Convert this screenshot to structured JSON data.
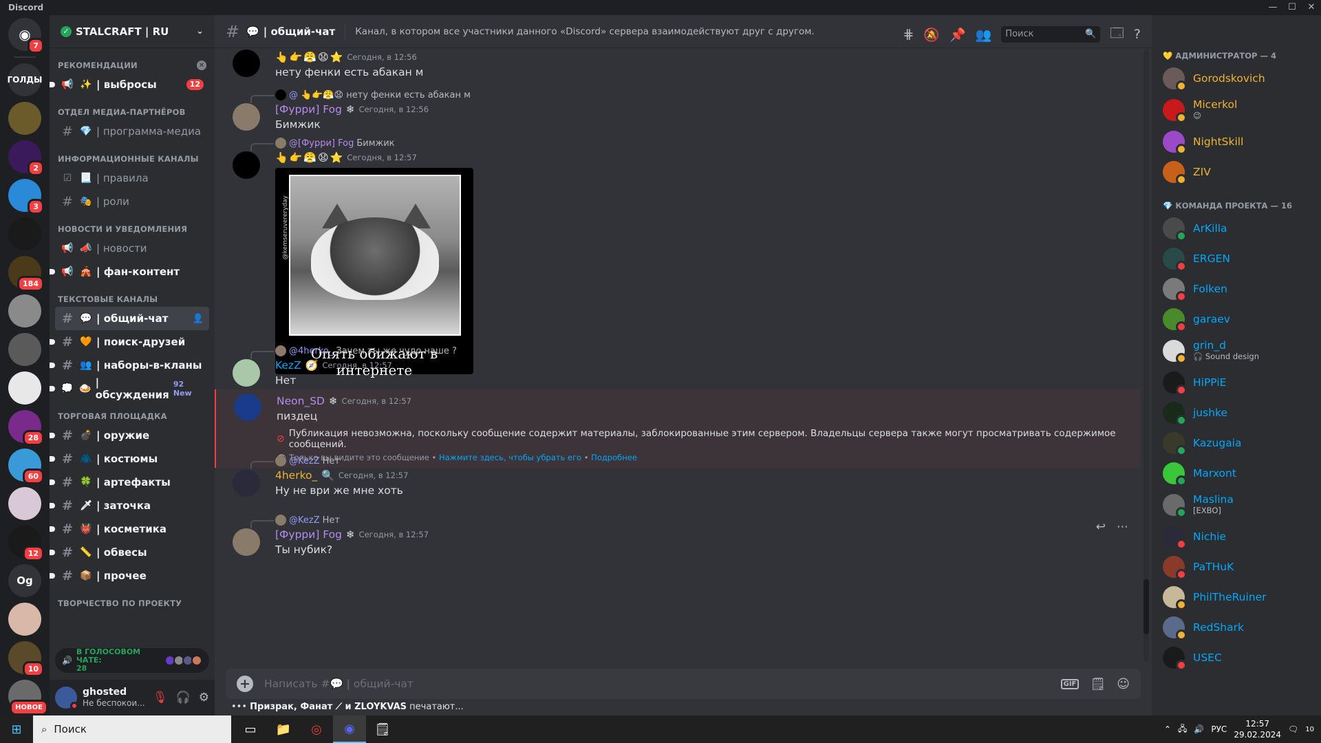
{
  "window": {
    "title": "Discord",
    "controls": [
      "—",
      "☐",
      "✕"
    ]
  },
  "rail": {
    "home_badge": "7",
    "servers": [
      {
        "label": "ГОЛДЫ",
        "color": "#313338",
        "badge": ""
      },
      {
        "label": "",
        "color": "#6b5a2a",
        "badge": ""
      },
      {
        "label": "",
        "color": "#3a1a5a",
        "badge": "2"
      },
      {
        "label": "",
        "color": "#2a8ad8",
        "badge": "3"
      },
      {
        "label": "",
        "color": "#1a1a1a",
        "badge": ""
      },
      {
        "label": "",
        "color": "#4a3a1a",
        "badge": "184"
      },
      {
        "label": "",
        "color": "#8a8a8a",
        "badge": ""
      },
      {
        "label": "",
        "color": "#5a5a5a",
        "badge": ""
      },
      {
        "label": "",
        "color": "#e8e8e8",
        "badge": ""
      },
      {
        "label": "",
        "color": "#7a2a8a",
        "badge": "28"
      },
      {
        "label": "",
        "color": "#3a9ad8",
        "badge": "60"
      },
      {
        "label": "",
        "color": "#d8c8d8",
        "badge": ""
      },
      {
        "label": "",
        "color": "#1a1a1a",
        "badge": "12"
      },
      {
        "label": "Og",
        "color": "#313338",
        "badge": ""
      },
      {
        "label": "",
        "color": "#d8b8a8",
        "badge": ""
      },
      {
        "label": "",
        "color": "#5a4a2a",
        "badge": "10"
      },
      {
        "label": "",
        "color": "#6a6a6a",
        "badge": "НОВОЕ"
      }
    ]
  },
  "guild": {
    "name": "STALCRAFT | RU",
    "categories": [
      {
        "name": "РЕКОМЕНДАЦИИ",
        "closable": true,
        "channels": [
          {
            "icon": "📢",
            "emoji": "✨",
            "name": "| выбросы",
            "state": "unread",
            "badge": "12",
            "new": ""
          }
        ]
      },
      {
        "name": "ОТДЕЛ МЕДИА-ПАРТНЁРОВ",
        "channels": [
          {
            "icon": "#",
            "emoji": "💎",
            "name": "| программа-медиа",
            "state": "",
            "badge": "",
            "new": ""
          }
        ]
      },
      {
        "name": "ИНФОРМАЦИОННЫЕ КАНАЛЫ",
        "channels": [
          {
            "icon": "☑",
            "emoji": "📃",
            "name": "| правила",
            "state": "",
            "badge": "",
            "new": ""
          },
          {
            "icon": "#",
            "emoji": "🎭",
            "name": "| роли",
            "state": "",
            "badge": "",
            "new": ""
          }
        ]
      },
      {
        "name": "НОВОСТИ И УВЕДОМЛЕНИЯ",
        "channels": [
          {
            "icon": "📢",
            "emoji": "📣",
            "name": "| новости",
            "state": "",
            "badge": "",
            "new": ""
          },
          {
            "icon": "📢",
            "emoji": "🎪",
            "name": "| фан-контент",
            "state": "unread",
            "badge": "",
            "new": ""
          }
        ]
      },
      {
        "name": "ТЕКСТОВЫЕ КАНАЛЫ",
        "channels": [
          {
            "icon": "#",
            "emoji": "💬",
            "name": "| общий-чат",
            "state": "active",
            "badge": "",
            "new": ""
          },
          {
            "icon": "#",
            "emoji": "🧡",
            "name": "| поиск-друзей",
            "state": "unread",
            "badge": "",
            "new": ""
          },
          {
            "icon": "#",
            "emoji": "👥",
            "name": "| наборы-в-кланы",
            "state": "unread",
            "badge": "",
            "new": ""
          },
          {
            "icon": "💭",
            "emoji": "🍛",
            "name": "| обсуждения",
            "state": "unread",
            "badge": "",
            "new": "92 New"
          }
        ]
      },
      {
        "name": "ТОРГОВАЯ ПЛОЩАДКА",
        "channels": [
          {
            "icon": "#",
            "emoji": "💣",
            "name": "| оружие",
            "state": "unread",
            "badge": "",
            "new": ""
          },
          {
            "icon": "#",
            "emoji": "🧥",
            "name": "| костюмы",
            "state": "unread",
            "badge": "",
            "new": ""
          },
          {
            "icon": "#",
            "emoji": "🍀",
            "name": "| артефакты",
            "state": "unread",
            "badge": "",
            "new": ""
          },
          {
            "icon": "#",
            "emoji": "🗡",
            "name": "| заточка",
            "state": "unread",
            "badge": "",
            "new": ""
          },
          {
            "icon": "#",
            "emoji": "👹",
            "name": "| косметика",
            "state": "unread",
            "badge": "",
            "new": ""
          },
          {
            "icon": "#",
            "emoji": "📏",
            "name": "| обвесы",
            "state": "unread",
            "badge": "",
            "new": ""
          },
          {
            "icon": "#",
            "emoji": "📦",
            "name": "| прочее",
            "state": "unread",
            "badge": "",
            "new": ""
          }
        ]
      },
      {
        "name": "ТВОРЧЕСТВО ПО ПРОЕКТУ",
        "channels": []
      }
    ]
  },
  "voice": {
    "label": "В ГОЛОСОВОМ ЧАТЕ:",
    "count": "28"
  },
  "user": {
    "name": "ghosted",
    "status": "Не беспокои..."
  },
  "chat": {
    "channel_emoji": "💬",
    "channel_name": "| общий-чат",
    "topic": "Канал, в котором все участники данного «Discord» сервера взаимодействуют друг с другом.",
    "search_placeholder": "Поиск",
    "composer_placeholder": "Написать #💬 | общий-чат",
    "typing": {
      "names": "Призрак, Фанат ⟋ и ZLOYKVAS",
      "suffix": " печатают..."
    },
    "messages": [
      {
        "author": "",
        "author_color": "#dbdee1",
        "emojis": "👆👉😤😧⭐",
        "time": "Сегодня, в 12:56",
        "text": "нету фенки есть абакан м",
        "avatar": "#000000",
        "reply_name": "",
        "reply_text": ""
      },
      {
        "author": "[Фурри] Fog",
        "author_color": "#b78bee",
        "emojis": "❄",
        "time": "Сегодня, в 12:56",
        "text": "Бимжик",
        "avatar": "#8a7a6a",
        "reply_name": "@",
        "reply_text": "👆👉😤😧 нету фенки есть абакан м"
      },
      {
        "author": "",
        "author_color": "#dbdee1",
        "emojis": "👆👉😤😧⭐",
        "time": "Сегодня, в 12:57",
        "text": "",
        "avatar": "#000000",
        "reply_name": "@[Фурри] Fog",
        "reply_text": "Бимжик",
        "gif": {
          "caption": "Опять обижают в интернете",
          "watermark": "@kemseruvereryday"
        }
      },
      {
        "author": "KezZ",
        "author_color": "#00a8fc",
        "emojis": "🧭",
        "time": "Сегодня, в 12:57",
        "text": "Нет",
        "avatar": "#a8c8a8",
        "reply_name": "@4herko_",
        "reply_text": "Зачем ты же чудо наше ?"
      },
      {
        "author": "Neon_SD",
        "author_color": "#b78bee",
        "emojis": "❄",
        "time": "Сегодня, в 12:57",
        "text": "пиздец",
        "avatar": "#1a3a8a",
        "reply_name": "",
        "reply_text": "",
        "blocked": {
          "text": "Публикация невозможна, поскольку сообщение содержит материалы, заблокированные этим сервером. Владельцы сервера также могут просматривать содержимое сообщений.",
          "only_you": "Только вы видите это сообщение •",
          "dismiss": "Нажмите здесь, чтобы убрать его",
          "sep": "•",
          "more": "Подробнее"
        }
      },
      {
        "author": "4herko_",
        "author_color": "#f0b232",
        "emojis": "🔍",
        "time": "Сегодня, в 12:57",
        "text": "Ну не ври же мне хоть",
        "avatar": "#2a2a3a",
        "reply_name": "@KezZ",
        "reply_text": "Нет"
      },
      {
        "author": "[Фурри] Fog",
        "author_color": "#b78bee",
        "emojis": "❄",
        "time": "Сегодня, в 12:57",
        "text": "Ты нубик?",
        "avatar": "#8a7a6a",
        "reply_name": "@KezZ",
        "reply_text": "Нет"
      }
    ]
  },
  "members": {
    "groups": [
      {
        "title": "💛 АДМИНИСТРАТОР — 4",
        "cls": "admin",
        "list": [
          {
            "name": "Gorodskovich",
            "sub": "",
            "color": "#6a5a5a",
            "status": "#f0b232"
          },
          {
            "name": "Micerkol",
            "sub": "😉",
            "color": "#c81a1a",
            "status": "#f0b232"
          },
          {
            "name": "NightSkill",
            "sub": "",
            "color": "#9a4ac8",
            "status": "#f0b232"
          },
          {
            "name": "ZIV",
            "sub": "",
            "color": "#c8601a",
            "status": "#f0b232"
          }
        ]
      },
      {
        "title": "💎 КОМАНДА ПРОЕКТА — 16",
        "cls": "team",
        "list": [
          {
            "name": "ArKilla",
            "sub": "",
            "color": "#4a4a4a",
            "status": "#23a55a"
          },
          {
            "name": "ERGEN",
            "sub": "",
            "color": "#2a4a4a",
            "status": "#f23f42"
          },
          {
            "name": "Folken",
            "sub": "",
            "color": "#7a7a7a",
            "status": "#f23f42"
          },
          {
            "name": "garaev",
            "sub": "",
            "color": "#4a8a2a",
            "status": "#f23f42"
          },
          {
            "name": "grin_d",
            "sub": "🎧 Sound design",
            "color": "#dadada",
            "status": "#f0b232"
          },
          {
            "name": "HiPPiE",
            "sub": "",
            "color": "#1a1a1a",
            "status": "#f23f42"
          },
          {
            "name": "jushke",
            "sub": "",
            "color": "#1a2a1a",
            "status": "#23a55a"
          },
          {
            "name": "Kazugaia",
            "sub": "",
            "color": "#3a3a2a",
            "status": "#23a55a"
          },
          {
            "name": "Marxont",
            "sub": "",
            "color": "#3ac83a",
            "status": "#23a55a"
          },
          {
            "name": "Maslina",
            "sub": "[EXBO]",
            "color": "#6a6a6a",
            "status": "#23a55a"
          },
          {
            "name": "Nichie",
            "sub": "",
            "color": "#2a2a3a",
            "status": "#f23f42"
          },
          {
            "name": "PaTHuK",
            "sub": "",
            "color": "#8a3a2a",
            "status": "#f23f42"
          },
          {
            "name": "PhilTheRuiner",
            "sub": "",
            "color": "#c8b89a",
            "status": "#f0b232"
          },
          {
            "name": "RedShark",
            "sub": "",
            "color": "#5a6a8a",
            "status": "#f0b232"
          },
          {
            "name": "USEC",
            "sub": "",
            "color": "#1a1a1a",
            "status": "#f23f42"
          }
        ]
      }
    ]
  },
  "taskbar": {
    "search": "Поиск",
    "lang": "РУС",
    "time": "12:57",
    "date": "29.02.2024",
    "notif": "10"
  }
}
